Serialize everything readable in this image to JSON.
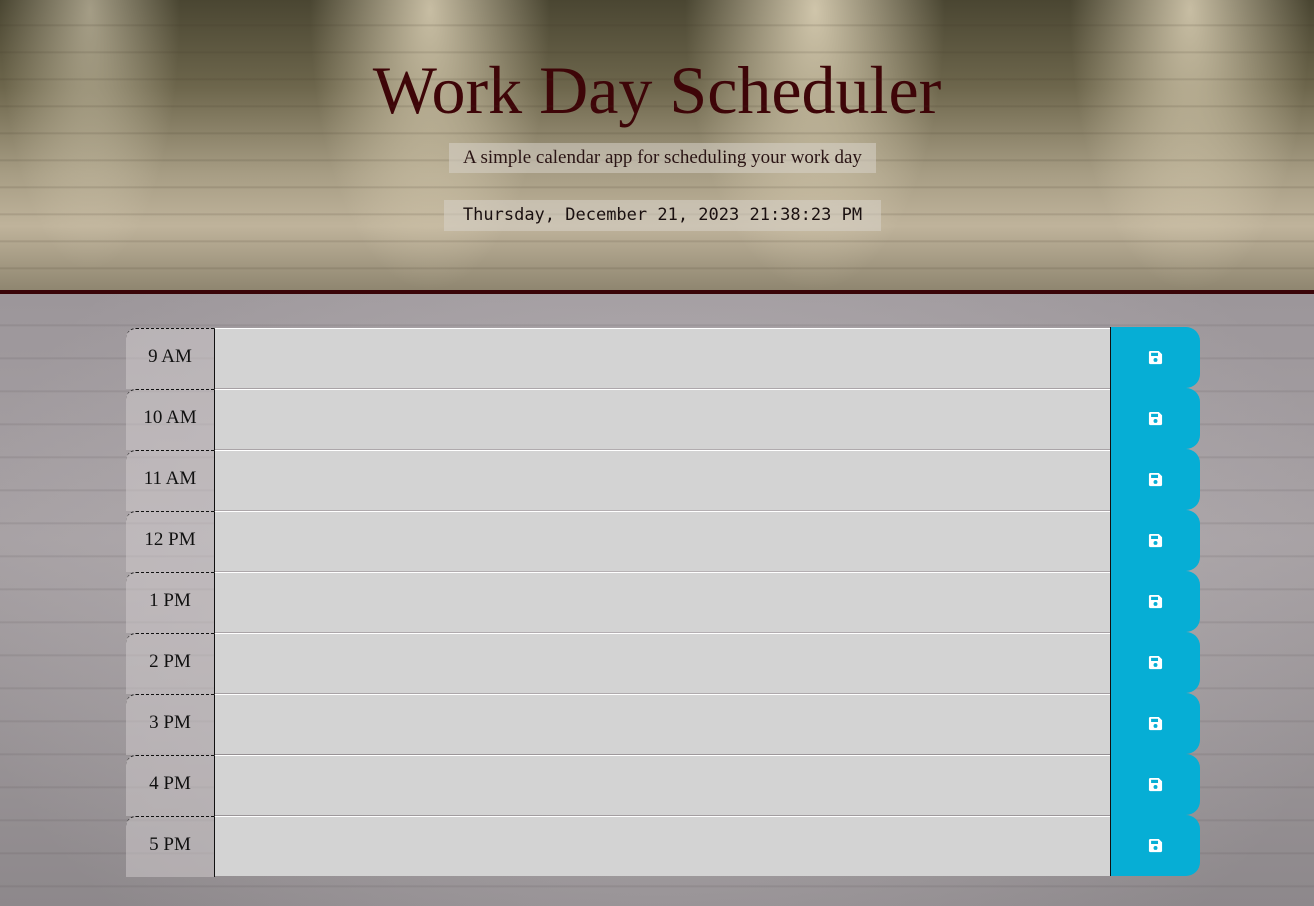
{
  "header": {
    "title": "Work Day Scheduler",
    "lead": "A simple calendar app for scheduling your work day",
    "current_day": "Thursday, December 21, 2023 21:38:23 PM"
  },
  "schedule": {
    "rows": [
      {
        "hour": "9 AM",
        "description": ""
      },
      {
        "hour": "10 AM",
        "description": ""
      },
      {
        "hour": "11 AM",
        "description": ""
      },
      {
        "hour": "12 PM",
        "description": ""
      },
      {
        "hour": "1 PM",
        "description": ""
      },
      {
        "hour": "2 PM",
        "description": ""
      },
      {
        "hour": "3 PM",
        "description": ""
      },
      {
        "hour": "4 PM",
        "description": ""
      },
      {
        "hour": "5 PM",
        "description": ""
      }
    ],
    "save_icon": "floppy-disk-icon"
  },
  "colors": {
    "title": "#3e0508",
    "header_border": "#3a0508",
    "past_row": "#d3d3d3",
    "save_button": "#06aed5",
    "save_icon": "#ffffff"
  }
}
